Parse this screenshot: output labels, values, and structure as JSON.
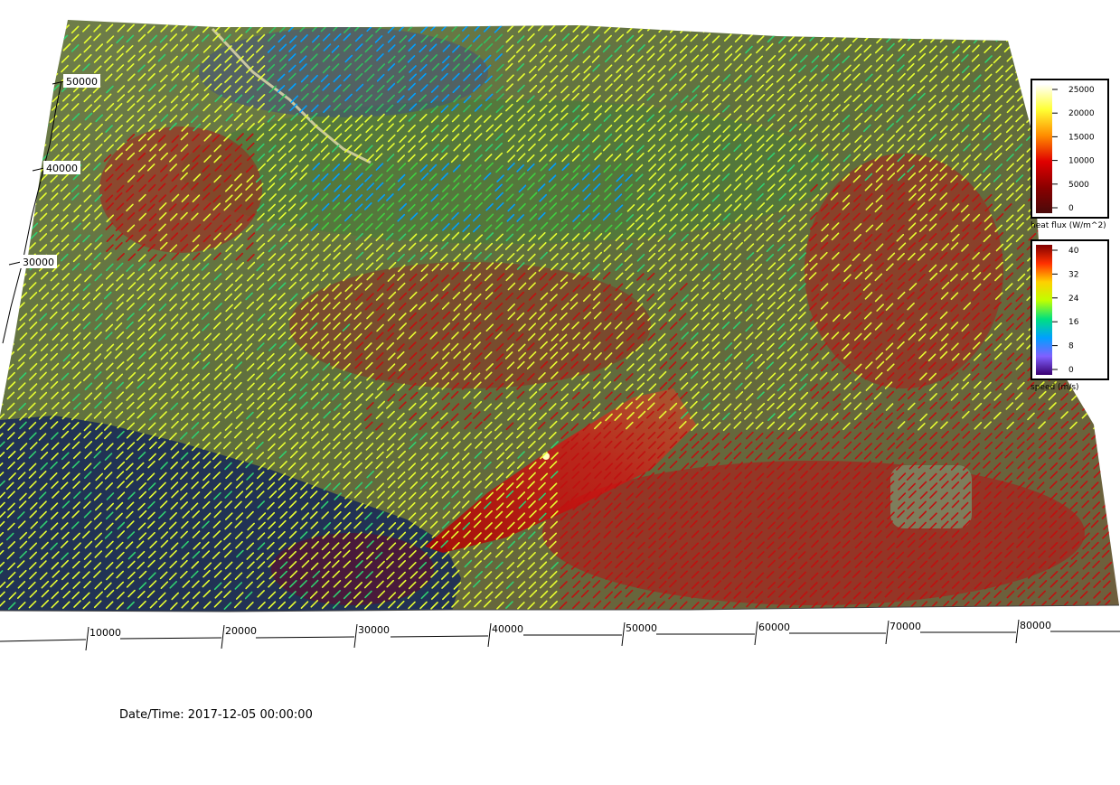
{
  "x_axis_ticks": [
    "10000",
    "20000",
    "30000",
    "40000",
    "50000",
    "60000",
    "70000",
    "80000"
  ],
  "y_axis_ticks": [
    "30000",
    "40000",
    "50000"
  ],
  "heat_flux_legend": {
    "title": "heat flux (W/m^2)",
    "ticks": [
      "0",
      "5000",
      "10000",
      "15000",
      "20000",
      "25000"
    ],
    "colors": [
      "#4a0a0a",
      "#8b0000",
      "#e00000",
      "#ff8c00",
      "#ffff33",
      "#ffffff"
    ]
  },
  "speed_legend": {
    "title": "speed (m/s)",
    "ticks": [
      "0",
      "8",
      "16",
      "24",
      "32",
      "40"
    ],
    "colors": [
      "#3a0070",
      "#8060ff",
      "#00a0ff",
      "#00e080",
      "#c0ff00",
      "#ffd000",
      "#ff3000",
      "#800000"
    ]
  },
  "datetime_label": "Date/Time: 2017-12-05 00:00:00",
  "colors": {
    "terrain": "#5a6b3c",
    "ocean": "#1a2a55",
    "arrow_low": "#00a0ff",
    "arrow_mid": "#e8ff30",
    "arrow_high": "#c01010"
  }
}
